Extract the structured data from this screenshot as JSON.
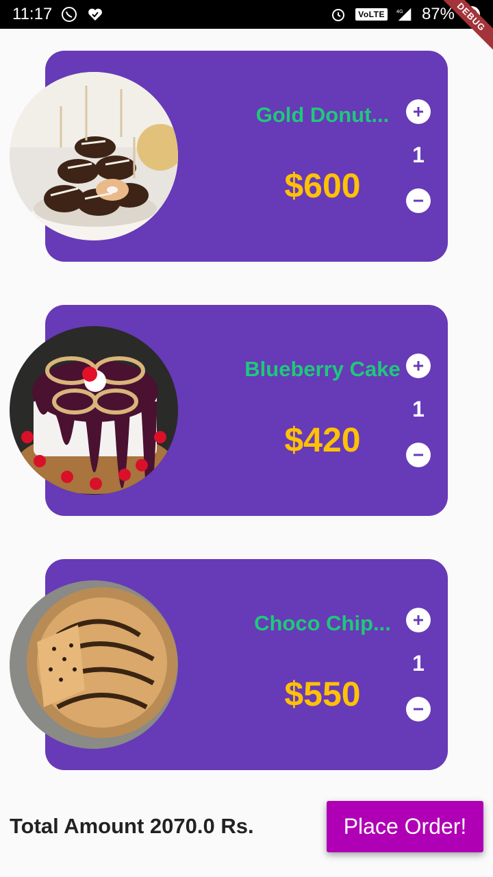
{
  "status_bar": {
    "time": "11:17",
    "volte": "VoLTE",
    "network": "4G",
    "battery": "87%"
  },
  "debug_banner": "DEBUG",
  "cart": {
    "items": [
      {
        "name": "Gold Donut...",
        "price": "$600",
        "quantity": "1"
      },
      {
        "name": "Blueberry Cake",
        "price": "$420",
        "quantity": "1"
      },
      {
        "name": "Choco Chip...",
        "price": "$550",
        "quantity": "1"
      }
    ]
  },
  "footer": {
    "total_text": "Total Amount 2070.0 Rs.",
    "order_button": "Place Order!"
  },
  "colors": {
    "card": "#673ab7",
    "name": "#1ec97a",
    "price": "#ffc107",
    "order_button": "#b000b5"
  }
}
